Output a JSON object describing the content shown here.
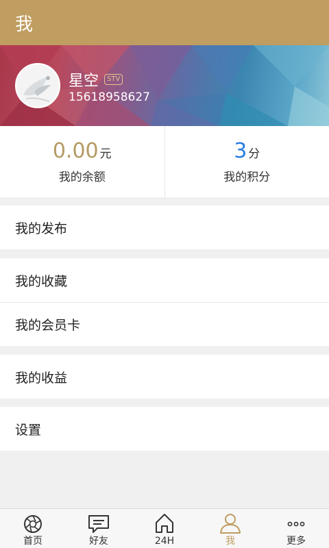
{
  "header": {
    "title": "我"
  },
  "profile": {
    "name": "星空",
    "badge": "STV",
    "phone": "15618958627"
  },
  "stats": {
    "balance": {
      "value": "0.00",
      "unit": "元",
      "label": "我的余额",
      "color": "#b49a63"
    },
    "points": {
      "value": "3",
      "unit": "分",
      "label": "我的积分",
      "color": "#2a7de1"
    }
  },
  "menu": {
    "publish": "我的发布",
    "favorites": "我的收藏",
    "membership": "我的会员卡",
    "earnings": "我的收益",
    "settings": "设置"
  },
  "tabbar": {
    "items": [
      {
        "label": "首页",
        "icon": "aperture-icon"
      },
      {
        "label": "好友",
        "icon": "chat-icon"
      },
      {
        "label": "24H",
        "icon": "home-icon"
      },
      {
        "label": "我",
        "icon": "person-icon",
        "active": true
      },
      {
        "label": "更多",
        "icon": "more-icon"
      }
    ]
  },
  "colors": {
    "accent": "#c09d60",
    "background": "#f0f0f0"
  }
}
